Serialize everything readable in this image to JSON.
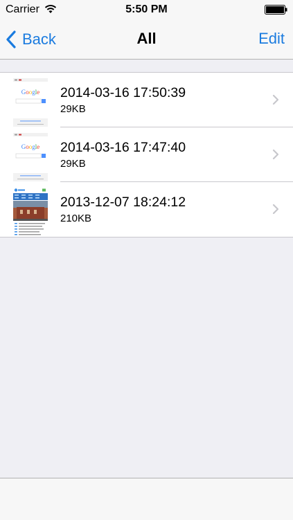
{
  "status_bar": {
    "carrier": "Carrier",
    "time": "5:50 PM",
    "wifi_icon": "wifi-icon",
    "battery_icon": "battery-icon"
  },
  "nav": {
    "back_label": "Back",
    "title": "All",
    "edit_label": "Edit",
    "accent_color": "#1a7bdf"
  },
  "list": {
    "items": [
      {
        "date": "2014-03-16 17:50:39",
        "size": "29KB",
        "thumbnail": "google-page-thumbnail"
      },
      {
        "date": "2014-03-16 17:47:40",
        "size": "29KB",
        "thumbnail": "google-page-thumbnail"
      },
      {
        "date": "2013-12-07 18:24:12",
        "size": "210KB",
        "thumbnail": "news-page-thumbnail"
      }
    ]
  },
  "colors": {
    "background": "#efeff4",
    "bar": "#f7f7f7",
    "separator": "#c8c7cc"
  }
}
